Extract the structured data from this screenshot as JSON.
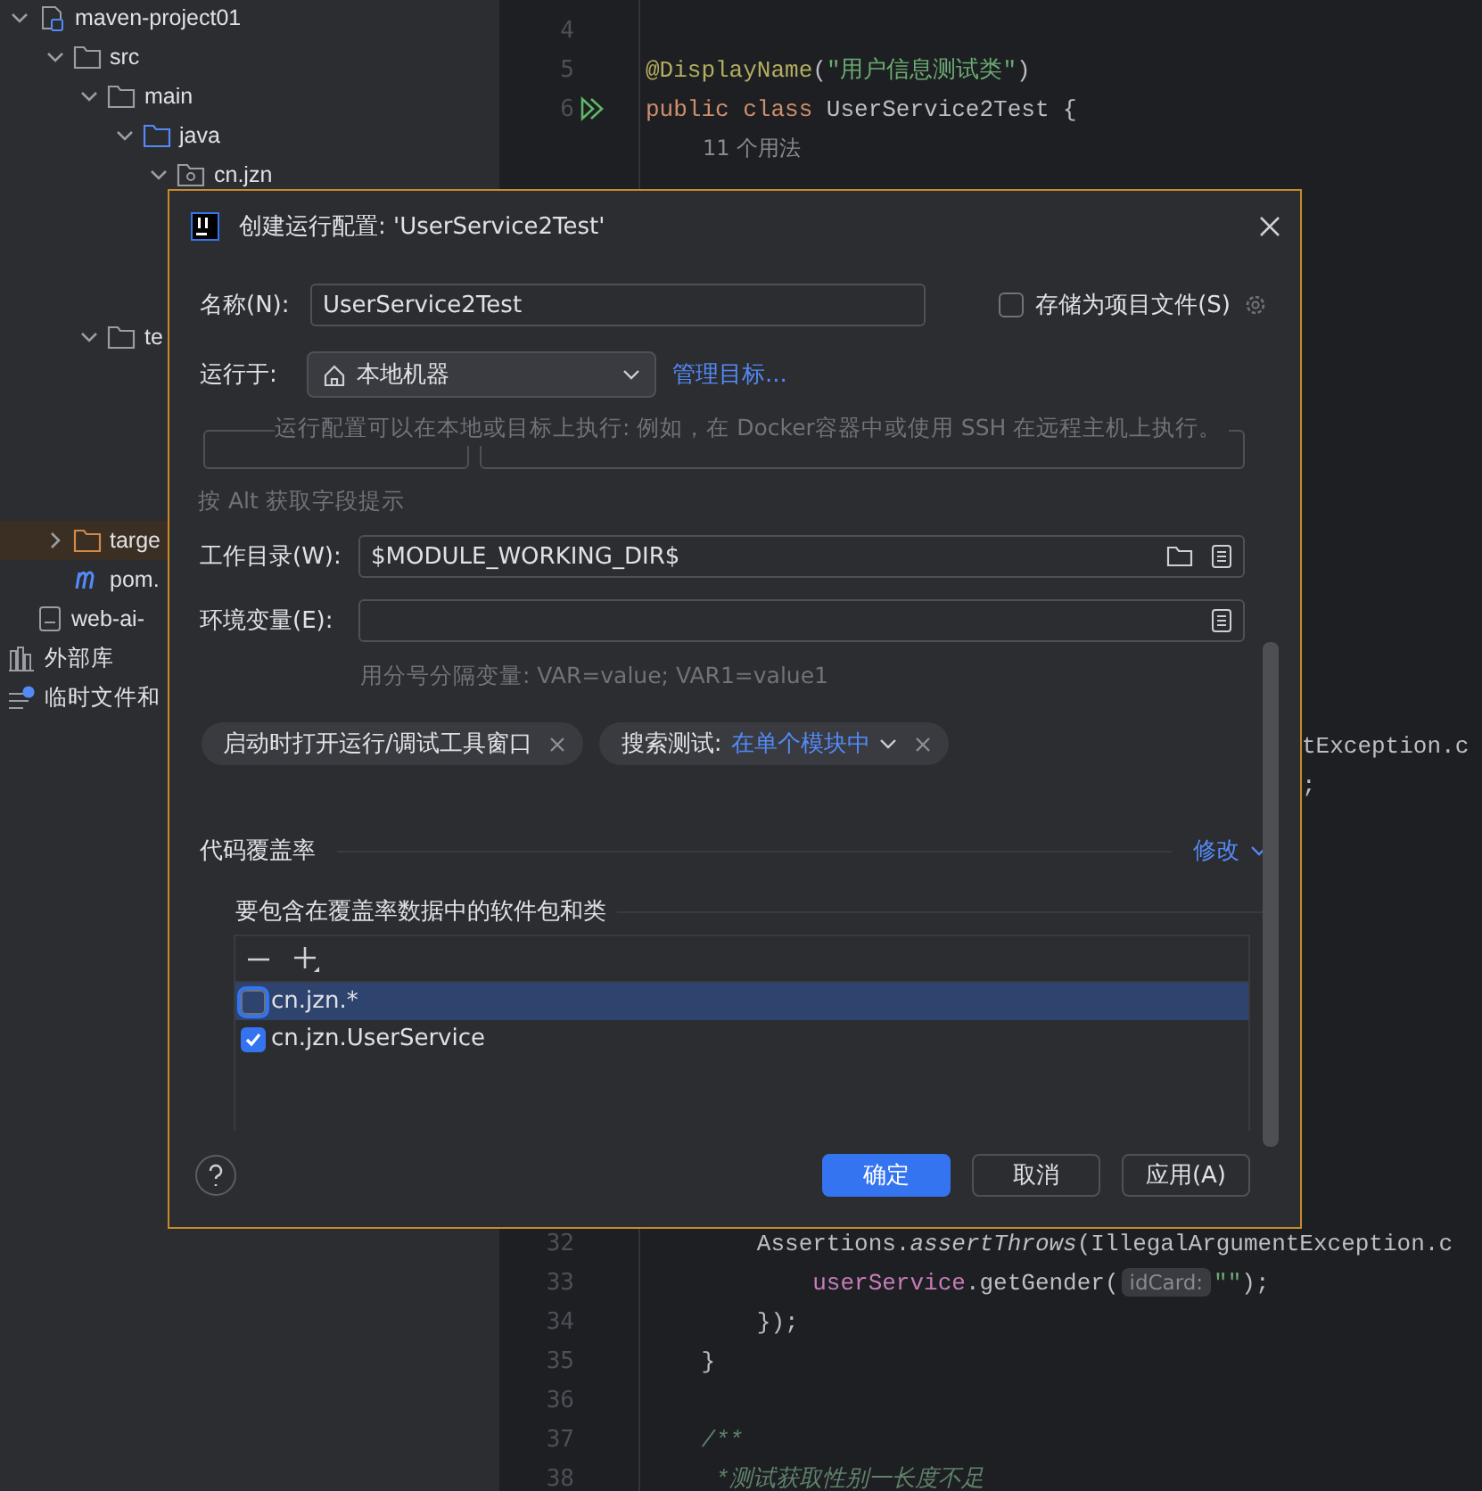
{
  "project_tree": [
    {
      "label": "maven-project01",
      "kind": "module",
      "expanded": true,
      "children": [
        {
          "label": "src",
          "kind": "folder",
          "expanded": true,
          "children": [
            {
              "label": "main",
              "kind": "folder",
              "expanded": true,
              "children": [
                {
                  "label": "java",
                  "kind": "source-folder",
                  "expanded": true,
                  "children": [
                    {
                      "label": "cn.jzn",
                      "kind": "package",
                      "expanded": true
                    }
                  ]
                }
              ]
            },
            {
              "label": "te",
              "kind": "folder",
              "expanded": true
            }
          ]
        },
        {
          "label": "targe",
          "kind": "excluded-folder",
          "expanded": false
        },
        {
          "label": "pom.",
          "kind": "maven-file"
        }
      ]
    },
    {
      "label": "web-ai-",
      "kind": "file"
    },
    {
      "label": "外部库",
      "kind": "library"
    },
    {
      "label": "临时文件和",
      "kind": "scratches"
    }
  ],
  "editor": {
    "top_lines": [
      {
        "number": "4",
        "runnable": false
      },
      {
        "number": "5",
        "runnable": false,
        "tokens": [
          {
            "kind": "annotation",
            "text": "@DisplayName"
          },
          {
            "kind": "plain",
            "text": "("
          },
          {
            "kind": "string",
            "text": "\"用户信息测试类\""
          },
          {
            "kind": "plain",
            "text": ")"
          }
        ]
      },
      {
        "number": "6",
        "runnable": true,
        "tokens": [
          {
            "kind": "keyword",
            "text": "public class "
          },
          {
            "kind": "plain",
            "text": "UserService2Test {"
          }
        ]
      },
      {
        "kind": "usages",
        "text": "11 个用法"
      }
    ],
    "fragments": [
      {
        "text": "tException.c"
      },
      {
        "text": ";"
      }
    ],
    "bottom_lines": [
      {
        "number": "32",
        "runnable": false,
        "tokens": [
          {
            "kind": "plain",
            "text": "        Assertions."
          },
          {
            "kind": "call-italic",
            "text": "assertThrows"
          },
          {
            "kind": "plain",
            "text": "(IllegalArgumentException.c"
          }
        ]
      },
      {
        "number": "33",
        "runnable": false,
        "tokens": [
          {
            "kind": "field",
            "text": "            userService"
          },
          {
            "kind": "plain",
            "text": ".getGender("
          },
          {
            "kind": "inlay",
            "text": "idCard:"
          },
          {
            "kind": "string",
            "text": "\"\""
          },
          {
            "kind": "plain",
            "text": ");"
          }
        ]
      },
      {
        "number": "34",
        "runnable": false,
        "tokens": [
          {
            "kind": "plain",
            "text": "        });"
          }
        ]
      },
      {
        "number": "35",
        "runnable": false,
        "tokens": [
          {
            "kind": "plain",
            "text": "    }"
          }
        ]
      },
      {
        "number": "36",
        "runnable": false
      },
      {
        "number": "37",
        "runnable": false,
        "tokens": [
          {
            "kind": "doc",
            "text": "    /**"
          }
        ]
      },
      {
        "number": "38",
        "runnable": false,
        "tokens": [
          {
            "kind": "doc",
            "text": "     *测试获取性别一长度不足"
          }
        ]
      }
    ]
  },
  "dialog": {
    "title": "创建运行配置: 'UserService2Test'",
    "name": {
      "label": "名称(N):",
      "value": "UserService2Test"
    },
    "store_option": {
      "label": "存储为项目文件(S)",
      "checked": false
    },
    "run_on": {
      "label": "运行于:",
      "value": "本地机器",
      "link": "管理目标..."
    },
    "run_on_hint": "运行配置可以在本地或目标上执行: 例如，在 Docker容器中或使用 SSH 在远程主机上执行。",
    "field_hint": "按 Alt 获取字段提示",
    "working_dir": {
      "label": "工作目录(W):",
      "value": "$MODULE_WORKING_DIR$"
    },
    "env_vars": {
      "label": "环境变量(E):"
    },
    "env_hint": "用分号分隔变量: VAR=value; VAR1=value1",
    "chips": [
      {
        "label": "启动时打开运行/调试工具窗口"
      },
      {
        "label": "搜索测试:",
        "value": "在单个模块中"
      }
    ],
    "coverage": {
      "title": "代码覆盖率",
      "link": "修改",
      "subtitle": "要包含在覆盖率数据中的软件包和类",
      "items": [
        {
          "label": "cn.jzn.*",
          "checked": false,
          "selected": true
        },
        {
          "label": "cn.jzn.UserService",
          "checked": true,
          "selected": false
        }
      ]
    },
    "buttons": [
      {
        "label": "确定",
        "kind": "primary"
      },
      {
        "label": "取消",
        "kind": "secondary"
      },
      {
        "label": "应用(A)",
        "kind": "secondary"
      }
    ]
  }
}
